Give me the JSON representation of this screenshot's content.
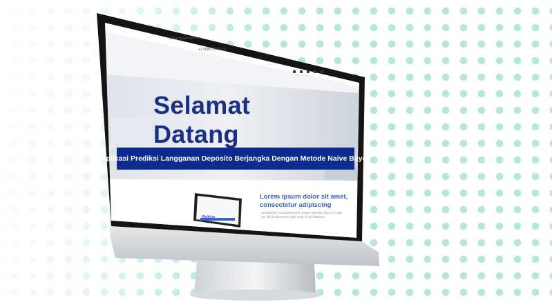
{
  "hero": {
    "heading": "Selamat Datang",
    "banner": "Aplikasi Prediksi Langganan Deposito Berjangka Dengan Metode Naive Bayes"
  },
  "topbar": {
    "email": "contoh@domain.com",
    "phone": "+1 5589 55488 55"
  },
  "feature": {
    "title": "Lorem ipsum dolor sit amet, consectetur adipiscing",
    "body": "Voluptatum et accusamus in eaque repellat. Sunt in culpa qui officia deserunt mollit anim id est laborum.",
    "laptop_text": "Walking"
  },
  "colors": {
    "accent": "#0d2a8f",
    "dots": "#b6e9dc"
  }
}
